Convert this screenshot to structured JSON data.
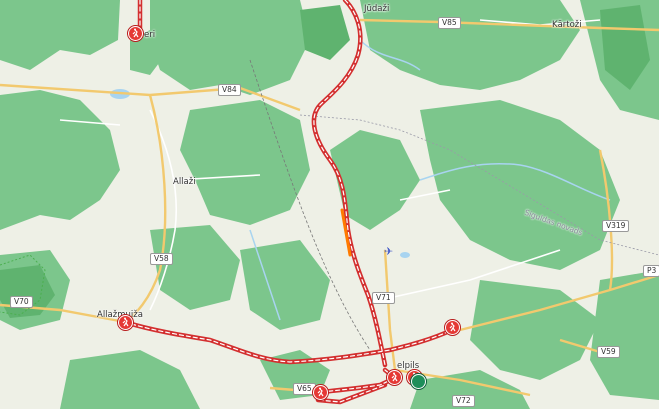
{
  "map": {
    "places": {
      "judazi": "Jūdaži",
      "kartozi": "Kārtoži",
      "allazi": "Allaži",
      "allazmuiza": "Allažmuiža",
      "vangazi_partial": "eri",
      "sigulda_partial": "elpils"
    },
    "roads": {
      "v85": "V85",
      "v84": "V84",
      "v58": "V58",
      "v70": "V70",
      "v71": "V71",
      "v72": "V72",
      "v65": "V65",
      "v319": "V319",
      "p3": "P3",
      "v59": "V59"
    },
    "municipalities": {
      "sigulda_novads": "Siguldas novads"
    },
    "colors": {
      "forest": "#7cc68c",
      "meadow": "#eef0e6",
      "route": "#d32f2f",
      "marker": "#e53935",
      "marker_green": "#1e8e5a",
      "road_main": "#f2c96e",
      "water": "#a8d4f0"
    },
    "icons": {
      "start_marker": "hiker-marker-icon",
      "end_marker": "green-pin-icon",
      "airport": "airplane-icon"
    }
  }
}
